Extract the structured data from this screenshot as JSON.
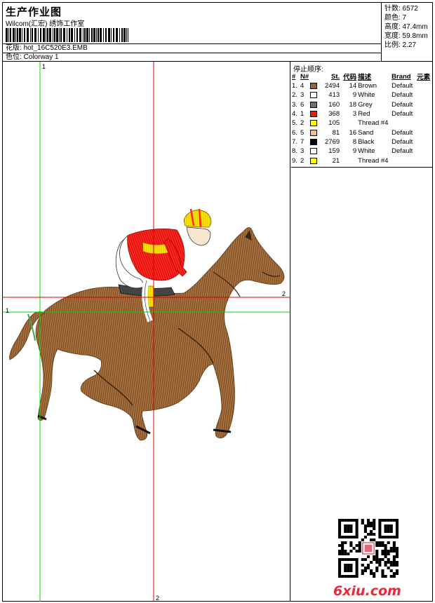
{
  "header": {
    "title": "生产作业图",
    "studio": "Wilcom(汇宏) 绣饰工作室",
    "design_label": "花版:",
    "design_file": "hot_16C520E3.EMB",
    "color_label": "色位:",
    "colorway": "Colorway 1"
  },
  "stats": {
    "stitches": "针数: 6572",
    "colors": "颜色: 7",
    "height": "高度: 47.4mm",
    "width": "宽度: 59.8mm",
    "scale": "比例: 2.27"
  },
  "stop_sequence": {
    "title": "停止顺序:",
    "headers": [
      "#",
      "N#",
      "St.",
      "代码",
      "描述",
      "Brand",
      "元素"
    ],
    "rows": [
      {
        "n": "1.",
        "needle": "4",
        "swatch": "#a0602c",
        "st": "2494",
        "code": "14",
        "desc": "Brown",
        "brand": "Default"
      },
      {
        "n": "2.",
        "needle": "3",
        "swatch": "#ffffff",
        "st": "413",
        "code": "9",
        "desc": "White",
        "brand": "Default"
      },
      {
        "n": "3.",
        "needle": "6",
        "swatch": "#707070",
        "st": "160",
        "code": "18",
        "desc": "Grey",
        "brand": "Default"
      },
      {
        "n": "4.",
        "needle": "1",
        "swatch": "#ff1010",
        "st": "368",
        "code": "3",
        "desc": "Red",
        "brand": "Default"
      },
      {
        "n": "5.",
        "needle": "2",
        "swatch": "#ffff00",
        "st": "105",
        "code": "",
        "desc": "Thread #4",
        "brand": ""
      },
      {
        "n": "6.",
        "needle": "5",
        "swatch": "#f0c090",
        "st": "81",
        "code": "16",
        "desc": "Sand",
        "brand": "Default"
      },
      {
        "n": "7.",
        "needle": "7",
        "swatch": "#000000",
        "st": "2769",
        "code": "8",
        "desc": "Black",
        "brand": "Default"
      },
      {
        "n": "8.",
        "needle": "3",
        "swatch": "#ffffff",
        "st": "159",
        "code": "9",
        "desc": "White",
        "brand": "Default"
      },
      {
        "n": "9.",
        "needle": "2",
        "swatch": "#ffff00",
        "st": "21",
        "code": "",
        "desc": "Thread #4",
        "brand": ""
      }
    ]
  },
  "axes": {
    "v1": "1",
    "v2": "2",
    "h1": "1",
    "h2": "2"
  },
  "watermark": {
    "brand": "6xiu.com",
    "color": "#e8293d"
  }
}
